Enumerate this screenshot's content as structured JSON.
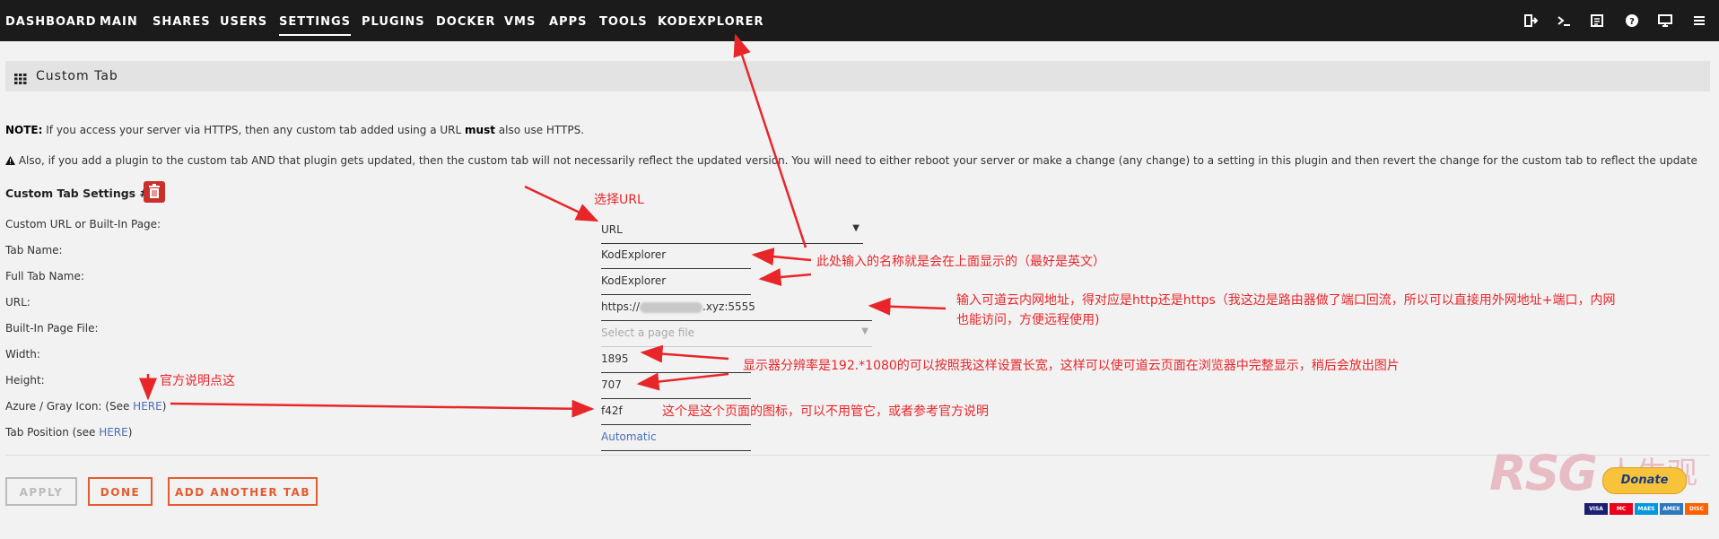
{
  "nav": {
    "items": [
      "DASHBOARD",
      "MAIN",
      "SHARES",
      "USERS",
      "SETTINGS",
      "PLUGINS",
      "DOCKER",
      "VMS",
      "APPS",
      "TOOLS",
      "KODEXPLORER"
    ],
    "active": "SETTINGS",
    "icons": [
      "logout-icon",
      "terminal-icon",
      "log-icon",
      "help-icon",
      "display-icon",
      "menu-icon"
    ]
  },
  "page": {
    "title": "Custom Tab"
  },
  "notes": {
    "note1_prefix": "NOTE:",
    "note1_a": " If you access your server via HTTPS, then any custom tab added using a URL ",
    "note1_bold": "must",
    "note1_b": " also use HTTPS.",
    "note2": " Also, if you add a plugin to the custom tab AND that plugin gets updated, then the custom tab will not necessarily reflect the updated version. You will need to either reboot your server or make a change (any change) to a setting in this plugin and then revert the change for the custom tab to reflect the update"
  },
  "settings": {
    "section_title": "Custom Tab Settings #0",
    "labels": {
      "type": "Custom URL or Built-In Page:",
      "tab_name": "Tab Name:",
      "full_tab_name": "Full Tab Name:",
      "url": "URL:",
      "builtin_file": "Built-In Page File:",
      "width": "Width:",
      "height": "Height:",
      "icon_prefix": "Azure / Gray Icon: (See ",
      "icon_link": "HERE",
      "icon_suffix": ")",
      "position_prefix": "Tab Position (see ",
      "position_link": "HERE",
      "position_suffix": ")"
    },
    "values": {
      "type": "URL",
      "tab_name": "KodExplorer",
      "full_tab_name": "KodExplorer",
      "url_prefix": "https://",
      "url_suffix": ".xyz:5555",
      "builtin_file_placeholder": "Select a page file",
      "width": "1895",
      "height": "707",
      "icon": "f42f",
      "position": "Automatic"
    }
  },
  "buttons": {
    "apply": "APPLY",
    "done": "DONE",
    "add": "ADD ANOTHER TAB"
  },
  "annotations": {
    "select_url": "选择URL",
    "tab_name_note": "此处输入的名称就是会在上面显示的（最好是英文）",
    "url_note_1": "输入可道云内网地址，得对应是http还是https（我这边是路由器做了端口回流，所以可以直接用外网地址+端口，内网",
    "url_note_2": "也能访问，方便远程使用)",
    "size_note": "显示器分辨率是192.*1080的可以按照我这样设置长宽，这样可以使可道云页面在浏览器中完整显示，稍后会放出图片",
    "official_note": "官方说明点这",
    "icon_note": "这个是这个页面的图标，可以不用管它，或者参考官方说明"
  },
  "watermark": {
    "brand": "RSG",
    "cn": "人生观",
    "donate": "Donate",
    "cards": [
      "VISA",
      "MC",
      "MAES",
      "AMEX",
      "DISC"
    ]
  },
  "colors": {
    "topbar": "#1c1b1b",
    "accent": "#e65b2e",
    "annotation": "#e8262a",
    "link": "#486dba",
    "delete": "#c9302c"
  }
}
